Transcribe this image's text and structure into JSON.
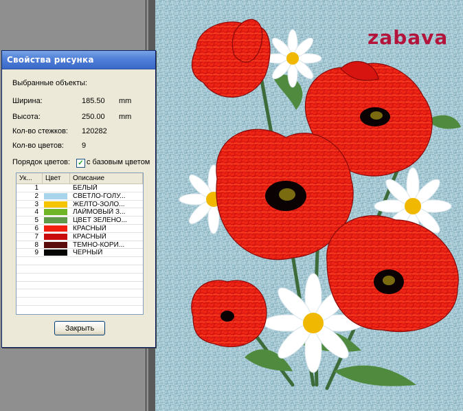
{
  "dialog": {
    "title": "Свойства рисунка",
    "selected_objects_label": "Выбранные объекты:",
    "width_label": "Ширина:",
    "width_value": "185.50",
    "width_unit": "mm",
    "height_label": "Высота:",
    "height_value": "250.00",
    "height_unit": "mm",
    "stitches_label": "Кол-во стежков:",
    "stitches_value": "120282",
    "colors_label": "Кол-во цветов:",
    "colors_value": "9",
    "order_label": "Порядок цветов:",
    "checkbox_label": "с базовым цветом",
    "checkbox_checked": true,
    "table": {
      "headers": [
        "Ук...",
        "Цвет",
        "Описание"
      ],
      "rows": [
        {
          "index": "1",
          "color": "#ffffff",
          "desc": "БЕЛЫЙ"
        },
        {
          "index": "2",
          "color": "#a8d4ec",
          "desc": "СВЕТЛО-ГОЛУ..."
        },
        {
          "index": "3",
          "color": "#f5c400",
          "desc": "ЖЕЛТО-ЗОЛО..."
        },
        {
          "index": "4",
          "color": "#6fb526",
          "desc": "ЛАЙМОВЫЙ З..."
        },
        {
          "index": "5",
          "color": "#5f9a4a",
          "desc": "ЦВЕТ ЗЕЛЕНО..."
        },
        {
          "index": "6",
          "color": "#f21e10",
          "desc": "КРАСНЫЙ"
        },
        {
          "index": "7",
          "color": "#c80c0c",
          "desc": "КРАСНЫЙ"
        },
        {
          "index": "8",
          "color": "#5a0c0c",
          "desc": "ТЕМНО-КОРИ..."
        },
        {
          "index": "9",
          "color": "#050505",
          "desc": "ЧЕРНЫЙ"
        }
      ]
    },
    "close_button": "Закрыть"
  },
  "canvas": {
    "watermark": "zabava",
    "background_color": "#a9cbd6"
  }
}
